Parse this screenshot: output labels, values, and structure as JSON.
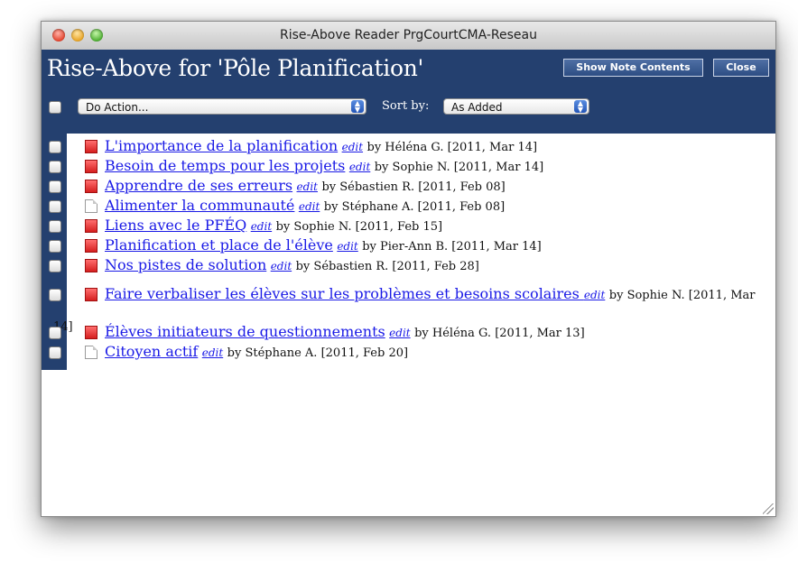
{
  "window": {
    "title": "Rise-Above Reader PrgCourtCMA-Reseau"
  },
  "header": {
    "title": "Rise-Above for 'Pôle Planification'",
    "show_notes_label": "Show Note Contents",
    "close_label": "Close"
  },
  "toolbar": {
    "action_value": "Do Action...",
    "sort_label": "Sort by:",
    "sort_value": "As Added"
  },
  "notes": [
    {
      "title": "L'importance de la planification",
      "edit": "edit",
      "meta": "by Héléna G. [2011, Mar 14]",
      "icon": "red-note"
    },
    {
      "title": "Besoin de temps pour les projets",
      "edit": "edit",
      "meta": "by Sophie N. [2011, Mar 14]",
      "icon": "red-note"
    },
    {
      "title": "Apprendre de ses erreurs",
      "edit": "edit",
      "meta": "by Sébastien R. [2011, Feb 08]",
      "icon": "red-note"
    },
    {
      "title": "Alimenter la communauté",
      "edit": "edit",
      "meta": "by Stéphane A. [2011, Feb 08]",
      "icon": "white-note"
    },
    {
      "title": "Liens avec le PFÉQ",
      "edit": "edit",
      "meta": "by Sophie N. [2011, Feb 15]",
      "icon": "red-note"
    },
    {
      "title": "Planification et place de l'élève",
      "edit": "edit",
      "meta": "by Pier-Ann B. [2011, Mar 14]",
      "icon": "red-note"
    },
    {
      "title": "Nos pistes de solution",
      "edit": "edit",
      "meta": "by Sébastien R. [2011, Feb 28]",
      "icon": "red-note"
    },
    {
      "title": "Faire verbaliser les élèves sur les problèmes et besoins scolaires ",
      "edit": "edit",
      "meta": "by Sophie N. [2011, Mar",
      "meta_wrap": "14]",
      "icon": "red-note"
    },
    {
      "title": "Élèves initiateurs de questionnements",
      "edit": "edit",
      "meta": "by Héléna G. [2011, Mar 13]",
      "icon": "red-note"
    },
    {
      "title": "Citoyen actif",
      "edit": "edit",
      "meta": "by Stéphane A. [2011, Feb 20]",
      "icon": "white-note"
    }
  ],
  "colors": {
    "header_bg": "#24406f",
    "link": "#1a1ae6",
    "note_red": "#d51e1e"
  }
}
